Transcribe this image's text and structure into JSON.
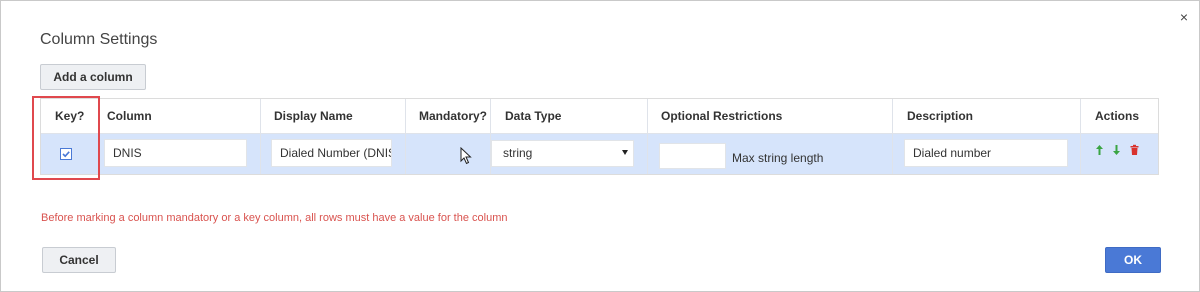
{
  "dialog": {
    "title": "Column Settings",
    "close_glyph": "×",
    "add_column_label": "Add a column",
    "cancel_label": "Cancel",
    "ok_label": "OK",
    "warning": "Before marking a column mandatory or a key column, all rows must have a value for the column"
  },
  "columns": {
    "key": "Key?",
    "column": "Column",
    "display_name": "Display Name",
    "mandatory": "Mandatory?",
    "data_type": "Data Type",
    "optional_restrictions": "Optional Restrictions",
    "description": "Description",
    "actions": "Actions"
  },
  "row": {
    "key_checked": true,
    "column": "DNIS",
    "display_name": "Dialed Number (DNIS)",
    "mandatory_checked": false,
    "data_type": "string",
    "restriction_value": "",
    "restriction_label": "Max string length",
    "description": "Dialed number",
    "actions": [
      "arrow-up-icon",
      "arrow-down-icon",
      "trash-icon"
    ]
  },
  "colors": {
    "accent": "#4a79d6",
    "row_highlight": "#d6e4fb",
    "warning": "#d9534f",
    "annotation": "#e0484d",
    "action_green": "#3aa543",
    "action_red": "#d9322e"
  }
}
